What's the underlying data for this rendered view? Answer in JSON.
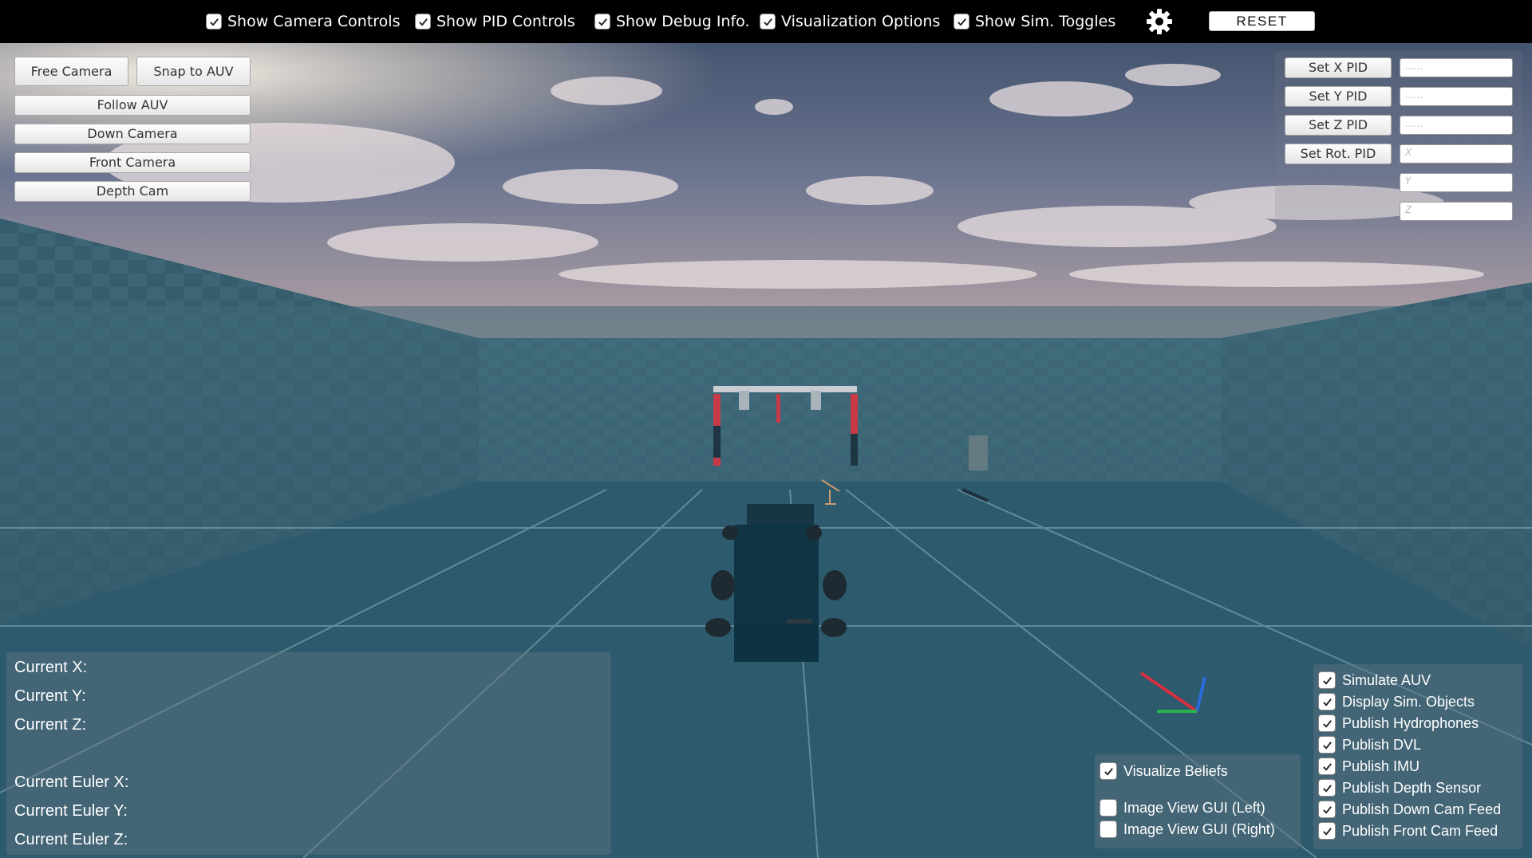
{
  "topbar": {
    "toggles": [
      {
        "label": "Show Camera Controls",
        "checked": true
      },
      {
        "label": "Show PID Controls",
        "checked": true
      },
      {
        "label": "Show Debug Info.",
        "checked": true
      },
      {
        "label": "Visualization Options",
        "checked": true
      },
      {
        "label": "Show Sim. Toggles",
        "checked": true
      }
    ],
    "settings_icon": "gear-icon",
    "reset_label": "RESET"
  },
  "camera": {
    "free": "Free Camera",
    "snap": "Snap to AUV",
    "follow": "Follow AUV",
    "down": "Down Camera",
    "front": "Front Camera",
    "depth": "Depth Cam"
  },
  "pid": {
    "set_x": "Set X PID",
    "set_y": "Set Y PID",
    "set_z": "Set Z PID",
    "set_rot": "Set Rot. PID",
    "x_value": "......",
    "y_value": "......",
    "z_value": "......",
    "rot_x_placeholder": "X",
    "rot_y_placeholder": "Y",
    "rot_z_placeholder": "Z"
  },
  "debug": {
    "current_x": "Current X:",
    "current_y": "Current Y:",
    "current_z": "Current Z:",
    "euler_x": "Current Euler X:",
    "euler_y": "Current Euler Y:",
    "euler_z": "Current Euler Z:"
  },
  "visualization": {
    "items": [
      {
        "label": "Visualize Beliefs",
        "checked": true
      },
      {
        "label": "Image View GUI (Left)",
        "checked": false
      },
      {
        "label": "Image View GUI (Right)",
        "checked": false
      }
    ]
  },
  "sim_toggles": {
    "items": [
      {
        "label": "Simulate AUV",
        "checked": true
      },
      {
        "label": "Display Sim. Objects",
        "checked": true
      },
      {
        "label": "Publish Hydrophones",
        "checked": true
      },
      {
        "label": "Publish DVL",
        "checked": true
      },
      {
        "label": "Publish IMU",
        "checked": true
      },
      {
        "label": "Publish Depth Sensor",
        "checked": true
      },
      {
        "label": "Publish Down Cam Feed",
        "checked": true
      },
      {
        "label": "Publish Front Cam Feed",
        "checked": true
      }
    ]
  },
  "colors": {
    "sky_top": "#4b5d7a",
    "water": "#2a5568",
    "accent_red": "#c83a48"
  }
}
